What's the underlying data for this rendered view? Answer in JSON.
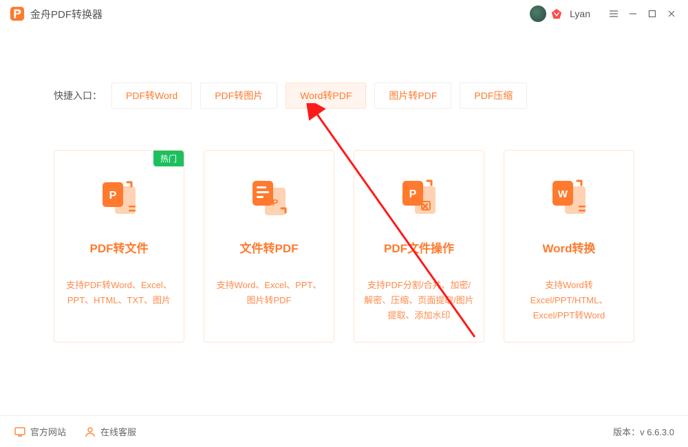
{
  "app": {
    "title": "金舟PDF转换器",
    "user": "Lyan"
  },
  "quick": {
    "label": "快捷入口：",
    "items": [
      {
        "label": "PDF转Word",
        "active": false
      },
      {
        "label": "PDF转图片",
        "active": false
      },
      {
        "label": "Word转PDF",
        "active": true
      },
      {
        "label": "图片转PDF",
        "active": false
      },
      {
        "label": "PDF压缩",
        "active": false
      }
    ]
  },
  "cards": [
    {
      "title": "PDF转文件",
      "desc": "支持PDF转Word、Excel、PPT、HTML、TXT、图片",
      "hot": "热门"
    },
    {
      "title": "文件转PDF",
      "desc": "支持Word、Excel、PPT、图片转PDF"
    },
    {
      "title": "PDF文件操作",
      "desc": "支持PDF分割/合并、加密/解密、压缩、页面提取/图片提取、添加水印"
    },
    {
      "title": "Word转换",
      "desc": "支持Word转Excel/PPT/HTML、Excel/PPT转Word"
    }
  ],
  "footer": {
    "website": "官方网站",
    "support": "在线客服",
    "version_label": "版本：",
    "version": "v 6.6.3.0"
  }
}
